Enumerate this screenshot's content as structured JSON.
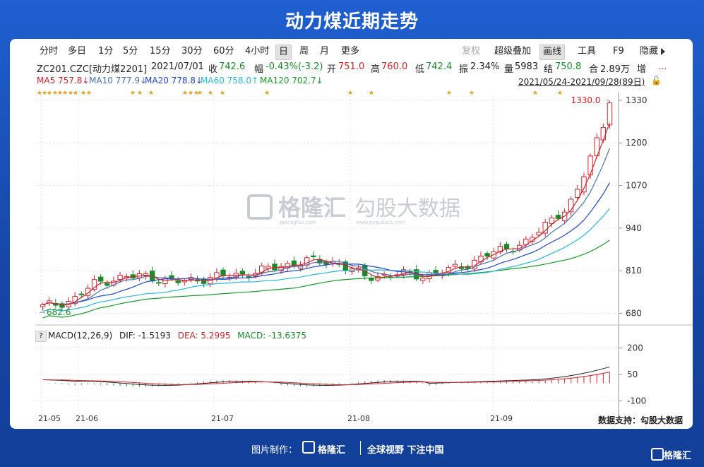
{
  "title": "动力煤近期走势",
  "toolbar": {
    "periods": [
      "分时",
      "多日",
      "1分",
      "5分",
      "15分",
      "30分",
      "60分",
      "4小时",
      "日",
      "周",
      "月",
      "更多"
    ],
    "active_period": "日",
    "right": [
      "复权",
      "超级叠加",
      "画线",
      "工具",
      "F9",
      "隐藏"
    ]
  },
  "info": {
    "code": "ZC201.CZC[动力煤2201]",
    "date": "2021/07/01",
    "close_label": "收",
    "close": "742.6",
    "change_label": "幅",
    "change": "-0.43%(-3.2)",
    "open_label": "开",
    "open": "751.0",
    "high_label": "高",
    "high": "760.0",
    "low_label": "低",
    "low": "742.4",
    "amp_label": "振",
    "amp": "2.34%",
    "vol_label": "量",
    "vol": "5983",
    "settle_label": "结",
    "settle": "750.8",
    "oi_label": "合",
    "oi": "2.89万",
    "inc_label": "增",
    "more": "..."
  },
  "ma": {
    "ma5": "MA5 757.8↓",
    "ma10": "MA10 777.9↓",
    "ma20": "MA20 778.8↓",
    "ma60": "MA60 758.0↑",
    "ma120": "MA120 702.7↓",
    "range": "2021/05/24-2021/09/28(89日)",
    "colors": {
      "ma5": "#d4232b",
      "ma10": "#4a6fb0",
      "ma20": "#2446c8",
      "ma60": "#28b8d8",
      "ma120": "#1a9a2a"
    }
  },
  "watermark": {
    "brand": "格隆汇",
    "cn": "勾股大数据",
    "sub1": "gelonghui.com",
    "sub2": "www.gogudata.com"
  },
  "chart_data": {
    "type": "line",
    "title": "",
    "y_ticks": [
      1330,
      1200,
      1070,
      940,
      810,
      680
    ],
    "ylim": [
      655,
      1345
    ],
    "x_ticks": [
      "21-05",
      "21-06",
      "21-07",
      "21-08",
      "21-09"
    ],
    "max_label": "1330.0",
    "min_label": "682.6",
    "macd": {
      "header": "MACD(12,26,9)",
      "dif": "DIF: -1.5193",
      "dea": "DEA: 5.2995",
      "macd": "MACD: -13.6375",
      "y_ticks": [
        200,
        50,
        -100
      ]
    }
  },
  "data_source": "数据支持：勾股大数据",
  "footer": {
    "made_by": "图片制作：",
    "brand": "格隆汇",
    "slogan": "全球视野 下注中国",
    "corner": "格隆汇"
  }
}
